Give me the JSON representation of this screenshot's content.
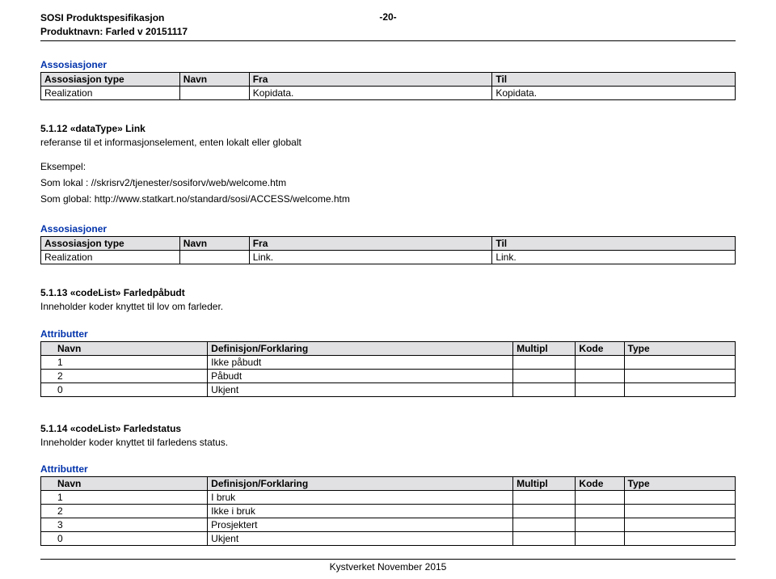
{
  "header": {
    "title": "SOSI Produktspesifikasjon",
    "product": "Produktnavn: Farled v 20151117",
    "page": "-20-"
  },
  "assoc1": {
    "title": "Assosiasjoner",
    "cols": {
      "type": "Assosiasjon type",
      "name": "Navn",
      "from": "Fra",
      "to": "Til"
    },
    "rows": [
      {
        "type": "Realization",
        "name": "",
        "from": "Kopidata.",
        "to": "Kopidata."
      }
    ]
  },
  "s12": {
    "heading": "5.1.12 «dataType» Link",
    "desc": "referanse  til et informasjonselement, enten lokalt eller globalt",
    "ex_label": "Eksempel:",
    "ex1": "Som lokal : //skrisrv2/tjenester/sosiforv/web/welcome.htm",
    "ex2": "Som global: http://www.statkart.no/standard/sosi/ACCESS/welcome.htm"
  },
  "assoc2": {
    "title": "Assosiasjoner",
    "cols": {
      "type": "Assosiasjon type",
      "name": "Navn",
      "from": "Fra",
      "to": "Til"
    },
    "rows": [
      {
        "type": "Realization",
        "name": "",
        "from": "Link.",
        "to": "Link."
      }
    ]
  },
  "s13": {
    "heading": "5.1.13 «codeList» Farledpåbudt",
    "desc": "Inneholder koder knyttet til lov om farleder."
  },
  "attr1": {
    "title": "Attributter",
    "cols": {
      "name": "Navn",
      "def": "Definisjon/Forklaring",
      "multipl": "Multipl",
      "kode": "Kode",
      "type": "Type"
    },
    "rows": [
      {
        "name": "1",
        "def": "Ikke påbudt",
        "multipl": "",
        "kode": "",
        "type": ""
      },
      {
        "name": "2",
        "def": "Påbudt",
        "multipl": "",
        "kode": "",
        "type": ""
      },
      {
        "name": "0",
        "def": "Ukjent",
        "multipl": "",
        "kode": "",
        "type": ""
      }
    ]
  },
  "s14": {
    "heading": "5.1.14 «codeList» Farledstatus",
    "desc": "Inneholder koder knyttet til farledens status."
  },
  "attr2": {
    "title": "Attributter",
    "cols": {
      "name": "Navn",
      "def": "Definisjon/Forklaring",
      "multipl": "Multipl",
      "kode": "Kode",
      "type": "Type"
    },
    "rows": [
      {
        "name": "1",
        "def": "I bruk",
        "multipl": "",
        "kode": "",
        "type": ""
      },
      {
        "name": "2",
        "def": "Ikke i bruk",
        "multipl": "",
        "kode": "",
        "type": ""
      },
      {
        "name": "3",
        "def": "Prosjektert",
        "multipl": "",
        "kode": "",
        "type": ""
      },
      {
        "name": "0",
        "def": "Ukjent",
        "multipl": "",
        "kode": "",
        "type": ""
      }
    ]
  },
  "footer": "Kystverket November 2015"
}
